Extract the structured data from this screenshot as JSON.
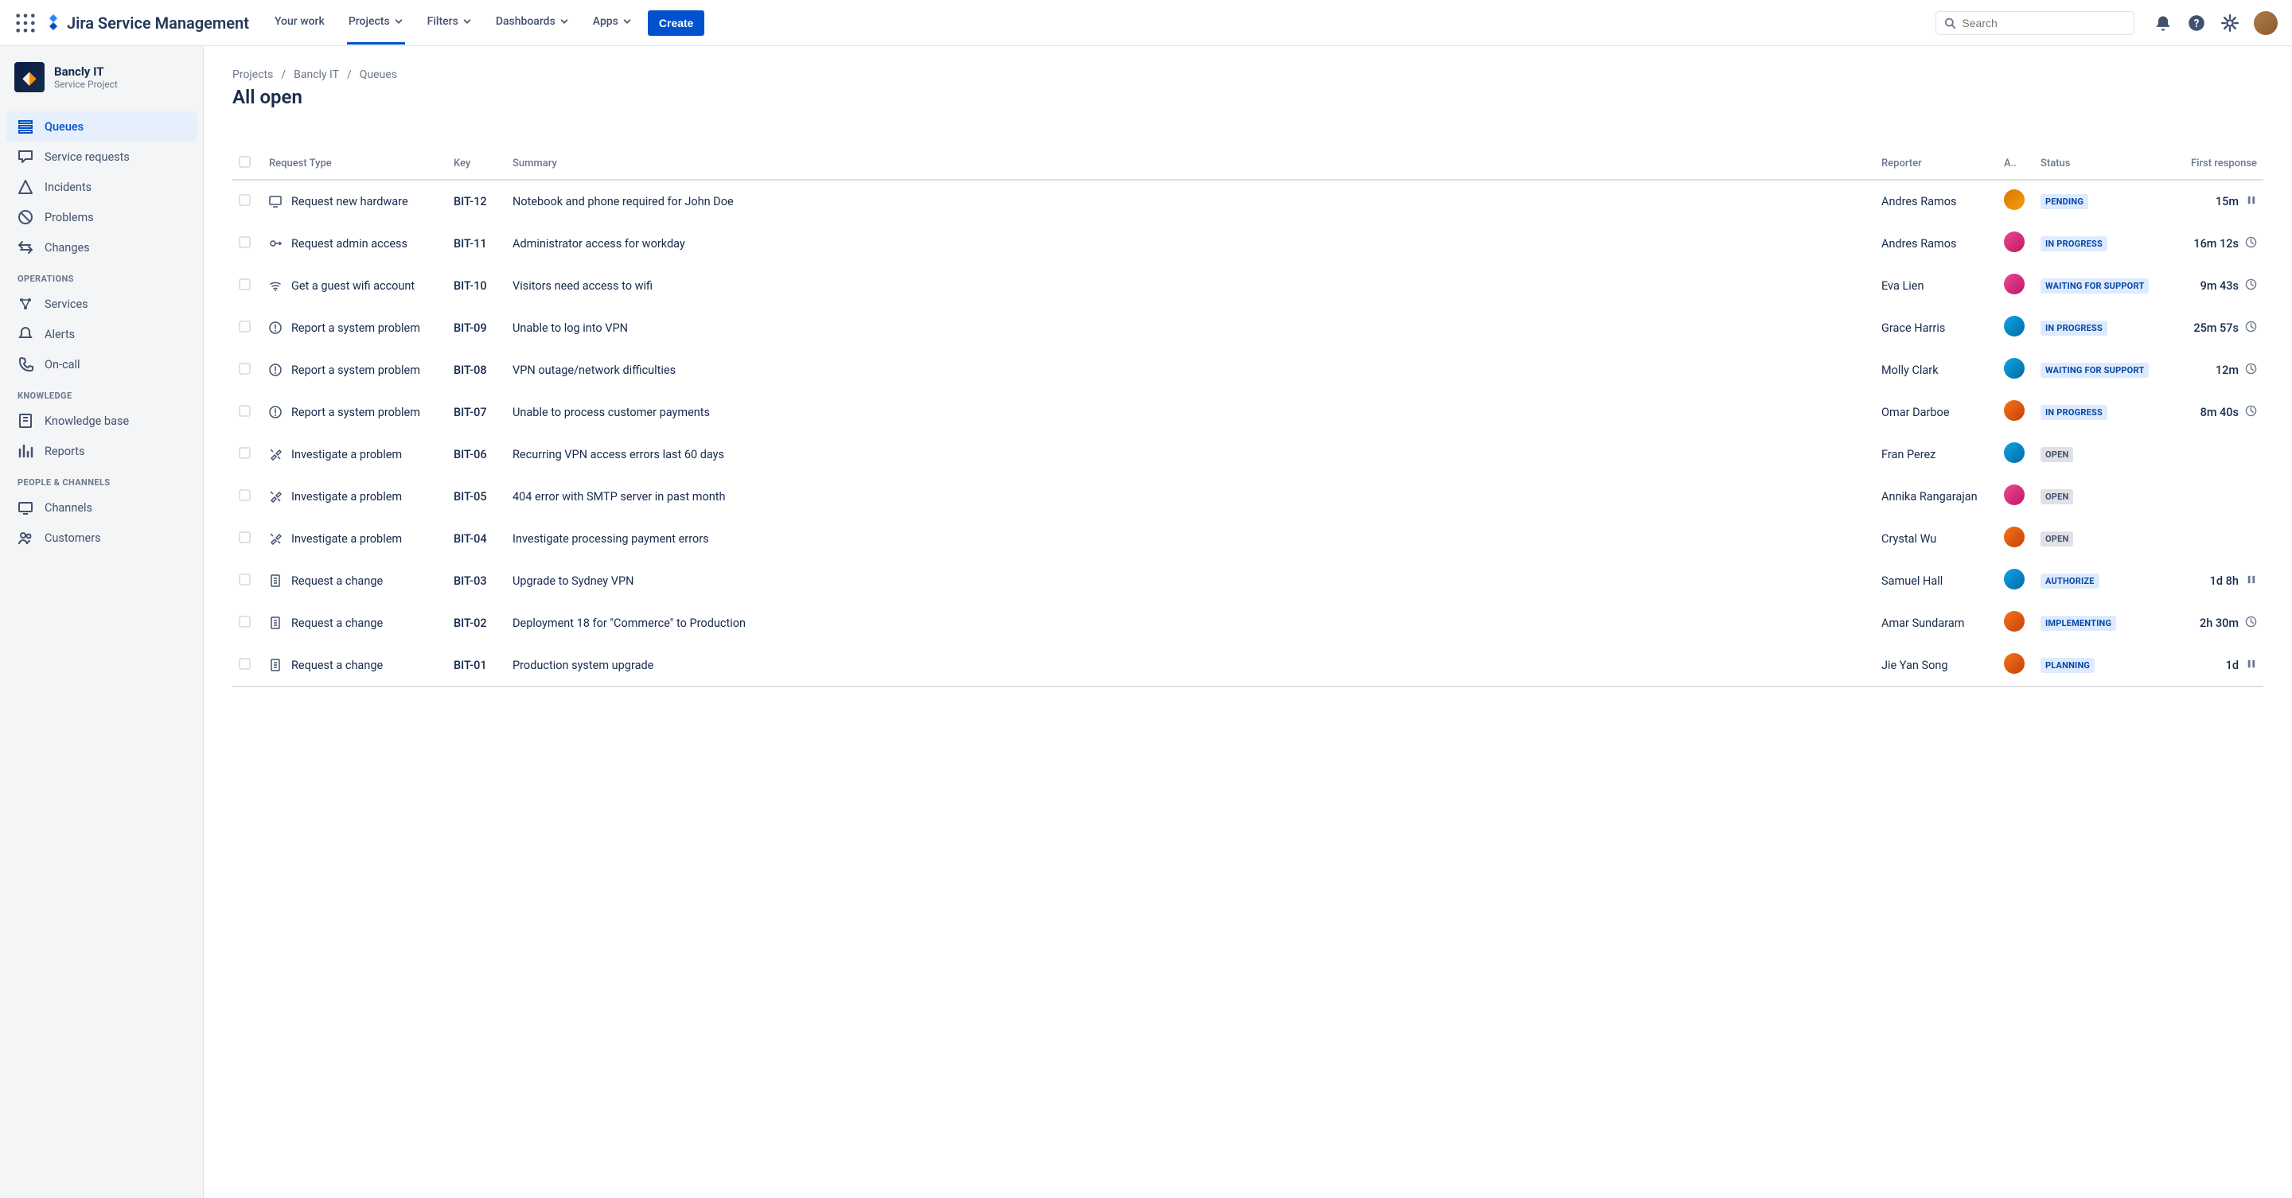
{
  "app": {
    "name": "Jira Service Management"
  },
  "topnav": {
    "items": [
      {
        "label": "Your work",
        "dropdown": false,
        "active": false
      },
      {
        "label": "Projects",
        "dropdown": true,
        "active": true
      },
      {
        "label": "Filters",
        "dropdown": true,
        "active": false
      },
      {
        "label": "Dashboards",
        "dropdown": true,
        "active": false
      },
      {
        "label": "Apps",
        "dropdown": true,
        "active": false
      }
    ],
    "create_label": "Create",
    "search_placeholder": "Search"
  },
  "project": {
    "name": "Bancly IT",
    "type": "Service Project"
  },
  "sidebar": {
    "main": [
      {
        "icon": "queues",
        "label": "Queues",
        "active": true
      },
      {
        "icon": "chat",
        "label": "Service requests"
      },
      {
        "icon": "incident",
        "label": "Incidents"
      },
      {
        "icon": "problem",
        "label": "Problems"
      },
      {
        "icon": "change",
        "label": "Changes"
      }
    ],
    "sections": [
      {
        "label": "OPERATIONS",
        "items": [
          {
            "icon": "services",
            "label": "Services"
          },
          {
            "icon": "bell",
            "label": "Alerts"
          },
          {
            "icon": "oncall",
            "label": "On-call"
          }
        ]
      },
      {
        "label": "KNOWLEDGE",
        "items": [
          {
            "icon": "book",
            "label": "Knowledge base"
          },
          {
            "icon": "reports",
            "label": "Reports"
          }
        ]
      },
      {
        "label": "PEOPLE & CHANNELS",
        "items": [
          {
            "icon": "channels",
            "label": "Channels"
          },
          {
            "icon": "customers",
            "label": "Customers"
          }
        ]
      }
    ]
  },
  "breadcrumbs": [
    "Projects",
    "Bancly IT",
    "Queues"
  ],
  "page_title": "All open",
  "columns": {
    "request_type": "Request Type",
    "key": "Key",
    "summary": "Summary",
    "reporter": "Reporter",
    "assignee": "A..",
    "status": "Status",
    "first_response": "First response"
  },
  "tickets": [
    {
      "rt_icon": "monitor",
      "request_type": "Request new hardware",
      "key": "BIT-12",
      "summary": "Notebook and phone required for John Doe",
      "reporter": "Andres Ramos",
      "assignee_av": "av1",
      "status": "PENDING",
      "status_cls": "st-pending",
      "first_response": "15m",
      "fr_icon": "pause"
    },
    {
      "rt_icon": "key",
      "request_type": "Request admin access",
      "key": "BIT-11",
      "summary": "Administrator access for workday",
      "reporter": "Andres Ramos",
      "assignee_av": "av2",
      "status": "IN PROGRESS",
      "status_cls": "st-inprogress",
      "first_response": "16m 12s",
      "fr_icon": "clock"
    },
    {
      "rt_icon": "wifi",
      "request_type": "Get a guest wifi account",
      "key": "BIT-10",
      "summary": "Visitors need access to wifi",
      "reporter": "Eva Lien",
      "assignee_av": "av2",
      "status": "WAITING FOR SUPPORT",
      "status_cls": "st-waiting",
      "first_response": "9m 43s",
      "fr_icon": "clock"
    },
    {
      "rt_icon": "alert",
      "request_type": "Report a system problem",
      "key": "BIT-09",
      "summary": "Unable to log into VPN",
      "reporter": "Grace Harris",
      "assignee_av": "av3",
      "status": "IN PROGRESS",
      "status_cls": "st-inprogress",
      "first_response": "25m 57s",
      "fr_icon": "clock"
    },
    {
      "rt_icon": "alert",
      "request_type": "Report a system problem",
      "key": "BIT-08",
      "summary": "VPN outage/network difficulties",
      "reporter": "Molly Clark",
      "assignee_av": "av3",
      "status": "WAITING FOR SUPPORT",
      "status_cls": "st-waiting",
      "first_response": "12m",
      "fr_icon": "clock"
    },
    {
      "rt_icon": "alert",
      "request_type": "Report a system problem",
      "key": "BIT-07",
      "summary": "Unable to process customer payments",
      "reporter": "Omar Darboe",
      "assignee_av": "av4",
      "status": "IN PROGRESS",
      "status_cls": "st-inprogress",
      "first_response": "8m 40s",
      "fr_icon": "clock"
    },
    {
      "rt_icon": "tools",
      "request_type": "Investigate a problem",
      "key": "BIT-06",
      "summary": "Recurring VPN access errors last 60 days",
      "reporter": "Fran Perez",
      "assignee_av": "av3",
      "status": "OPEN",
      "status_cls": "st-open",
      "first_response": "",
      "fr_icon": ""
    },
    {
      "rt_icon": "tools",
      "request_type": "Investigate a problem",
      "key": "BIT-05",
      "summary": "404 error with SMTP server in past month",
      "reporter": "Annika Rangarajan",
      "assignee_av": "av2",
      "status": "OPEN",
      "status_cls": "st-open",
      "first_response": "",
      "fr_icon": ""
    },
    {
      "rt_icon": "tools",
      "request_type": "Investigate a problem",
      "key": "BIT-04",
      "summary": "Investigate processing payment errors",
      "reporter": "Crystal Wu",
      "assignee_av": "av4",
      "status": "OPEN",
      "status_cls": "st-open",
      "first_response": "",
      "fr_icon": ""
    },
    {
      "rt_icon": "doc",
      "request_type": "Request a change",
      "key": "BIT-03",
      "summary": "Upgrade to Sydney VPN",
      "reporter": "Samuel Hall",
      "assignee_av": "av3",
      "status": "AUTHORIZE",
      "status_cls": "st-authorize",
      "first_response": "1d 8h",
      "fr_icon": "pause"
    },
    {
      "rt_icon": "doc",
      "request_type": "Request a change",
      "key": "BIT-02",
      "summary": "Deployment 18 for \"Commerce\" to Production",
      "reporter": "Amar Sundaram",
      "assignee_av": "av4",
      "status": "IMPLEMENTING",
      "status_cls": "st-implementing",
      "first_response": "2h 30m",
      "fr_icon": "clock"
    },
    {
      "rt_icon": "doc",
      "request_type": "Request a change",
      "key": "BIT-01",
      "summary": "Production system upgrade",
      "reporter": "Jie Yan Song",
      "assignee_av": "av4",
      "status": "PLANNING",
      "status_cls": "st-planning",
      "first_response": "1d",
      "fr_icon": "pause"
    }
  ]
}
